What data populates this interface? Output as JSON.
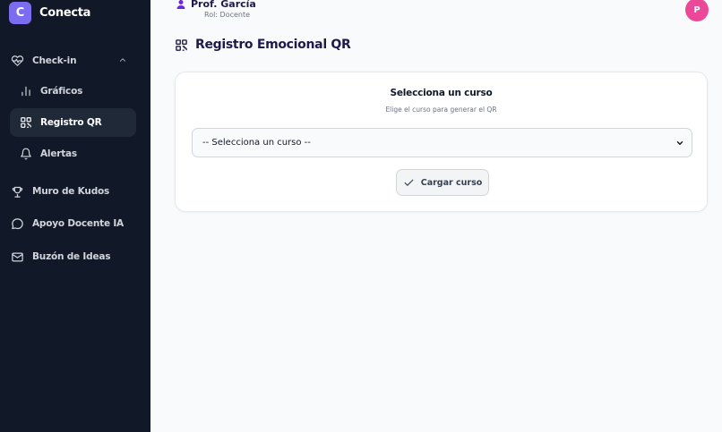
{
  "app": {
    "logo_letter": "C",
    "name": "Conecta",
    "accent": "#7c6cf0"
  },
  "sidebar": {
    "group": {
      "label": "Check-in",
      "icon": "heart-pulse-icon",
      "expanded": true
    },
    "sub_items": [
      {
        "label": "Gráficos",
        "icon": "bar-chart-icon"
      },
      {
        "label": "Registro QR",
        "icon": "qr-code-icon",
        "active": true
      },
      {
        "label": "Alertas",
        "icon": "bell-icon"
      }
    ],
    "items": [
      {
        "label": "Muro de Kudos",
        "icon": "trophy-icon"
      },
      {
        "label": "Apoyo Docente IA",
        "icon": "chat-bubble-icon"
      },
      {
        "label": "Buzón de Ideas",
        "icon": "mail-icon"
      }
    ]
  },
  "header": {
    "user_name": "Prof. García",
    "user_role": "Rol: Docente",
    "avatar_letter": "P"
  },
  "page": {
    "title": "Registro Emocional QR"
  },
  "card": {
    "title": "Selecciona un curso",
    "subtitle": "Elige el curso para generar el QR",
    "select_value": "-- Selecciona un curso --",
    "button_label": "Cargar curso"
  }
}
